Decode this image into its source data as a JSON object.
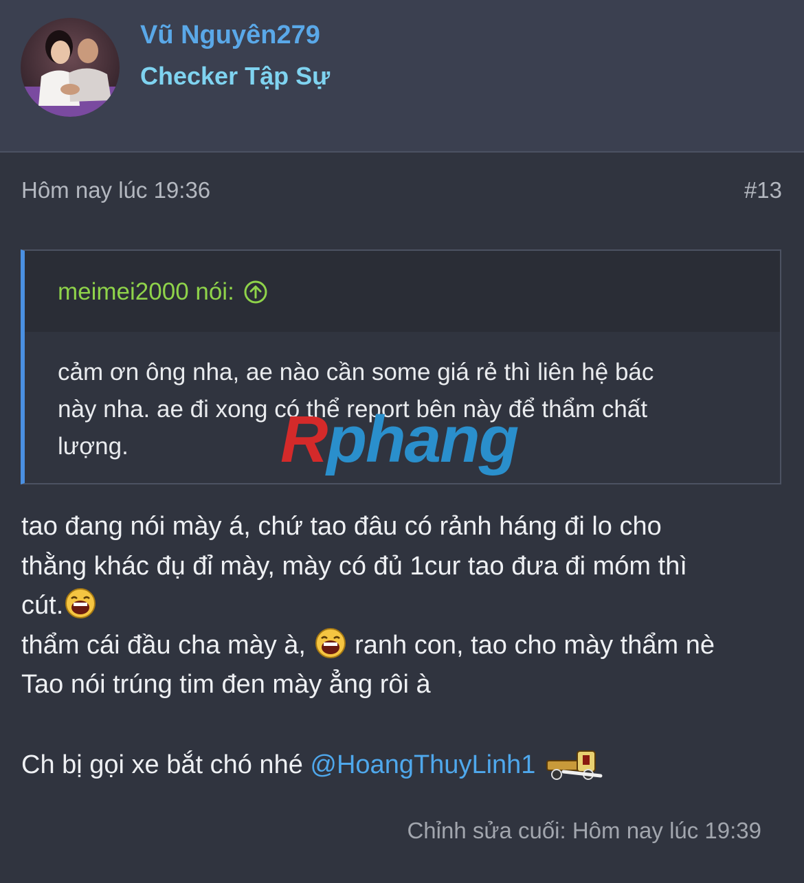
{
  "user": {
    "name": "Vũ Nguyên279",
    "title": "Checker Tập Sự"
  },
  "post": {
    "time": "Hôm nay lúc 19:36",
    "number": "#13",
    "last_edit": "Chỉnh sửa cuối: Hôm nay lúc 19:39"
  },
  "quote": {
    "author": "meimei2000 nói:",
    "lines": [
      "cảm ơn ông nha, ae nào cần some giá rẻ thì liên hệ bác",
      "này nha. ae đi xong có thể report bên này để thẩm chất",
      "lượng."
    ],
    "jump_icon": "arrow-up-circle-icon"
  },
  "watermark": {
    "first": "R",
    "rest": "phang"
  },
  "message": {
    "line1": "tao đang nói mày á, chứ tao đâu có rảnh háng đi lo cho",
    "line2": "thằng khác đụ đỉ mày, mày có đủ 1cur tao đưa đi móm thì",
    "line3": "cút.",
    "line4a": "thẩm cái đầu cha mày à,",
    "line4b": " ranh con, tao cho mày thẩm nè",
    "line5": "Tao nói trúng tim đen mày ẳng rôi à",
    "line6": "Ch bị gọi xe bắt chó nhé",
    "mention": "@HoangThuyLinh1",
    "smilies": [
      "laughing-smilie",
      "laughing-smilie",
      "dog-catcher-smilie"
    ]
  },
  "colors": {
    "background": "#30343f",
    "header_bg": "#3b4050",
    "username": "#5aa8e8",
    "user_title": "#7fd3f0",
    "quote_author": "#8fd34a",
    "quote_border": "#4a90e2",
    "mention": "#4fa8ec"
  }
}
